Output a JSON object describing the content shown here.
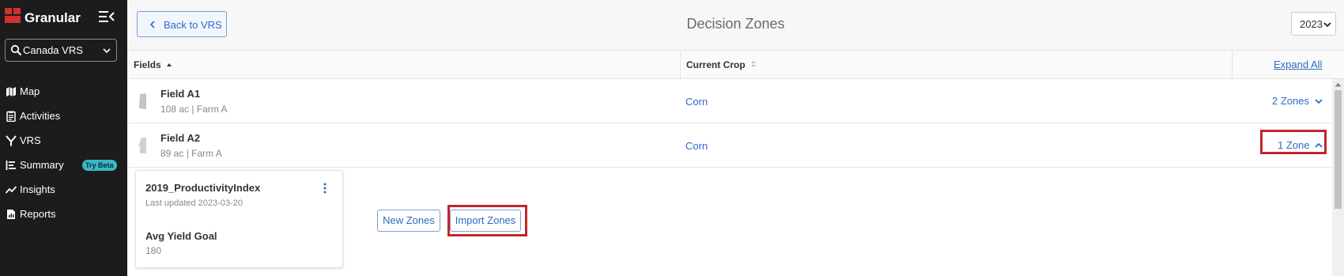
{
  "brand": {
    "name": "Granular"
  },
  "account": {
    "label": "Canada VRS"
  },
  "nav": [
    {
      "label": "Map",
      "icon": "map-icon"
    },
    {
      "label": "Activities",
      "icon": "clipboard-icon"
    },
    {
      "label": "VRS",
      "icon": "vrs-icon"
    },
    {
      "label": "Summary",
      "icon": "summary-icon",
      "badge": "Try Beta"
    },
    {
      "label": "Insights",
      "icon": "trend-icon"
    },
    {
      "label": "Reports",
      "icon": "report-icon"
    }
  ],
  "header": {
    "back_label": "Back to VRS",
    "title": "Decision Zones",
    "year": "2023"
  },
  "table": {
    "columns": {
      "fields": "Fields",
      "crop": "Current Crop",
      "expand_all": "Expand All"
    },
    "rows": [
      {
        "name": "Field A1",
        "meta": "108 ac | Farm A",
        "crop": "Corn",
        "zones": "2 Zones",
        "expanded": false
      },
      {
        "name": "Field A2",
        "meta": "89 ac | Farm A",
        "crop": "Corn",
        "zones": "1 Zone",
        "expanded": true
      }
    ]
  },
  "zone_card": {
    "title": "2019_ProductivityIndex",
    "updated": "Last updated 2023-03-20",
    "goal_label": "Avg Yield Goal",
    "goal_value": "180"
  },
  "actions": {
    "new_zones": "New Zones",
    "import_zones": "Import Zones"
  },
  "colors": {
    "accent": "#2e6bc6",
    "highlight": "#c0272d",
    "sidebar": "#1c1c1c",
    "brand_red": "#d3302f",
    "beta": "#38b8c8"
  }
}
